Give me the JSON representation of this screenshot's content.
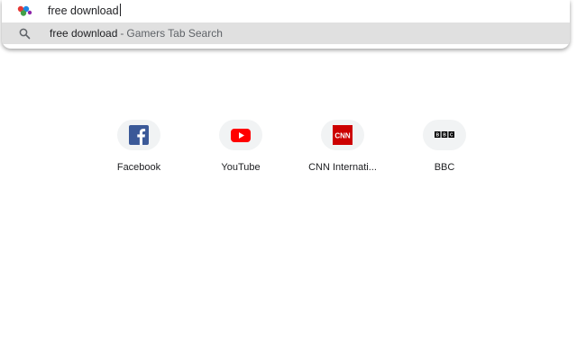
{
  "omnibox": {
    "query": "free download",
    "site_icon": "colorful-dots-logo-icon"
  },
  "suggestion": {
    "icon": "search-icon",
    "query": "free download",
    "separator": "-",
    "source": "Gamers Tab Search"
  },
  "shortcuts": [
    {
      "label": "Facebook",
      "icon": "facebook-icon",
      "color": "#3b5998"
    },
    {
      "label": "YouTube",
      "icon": "youtube-icon",
      "color": "#ff0000"
    },
    {
      "label": "CNN Internati...",
      "icon": "cnn-icon",
      "color": "#cc0000"
    },
    {
      "label": "BBC",
      "icon": "bbc-icon",
      "color": "#000000"
    }
  ]
}
